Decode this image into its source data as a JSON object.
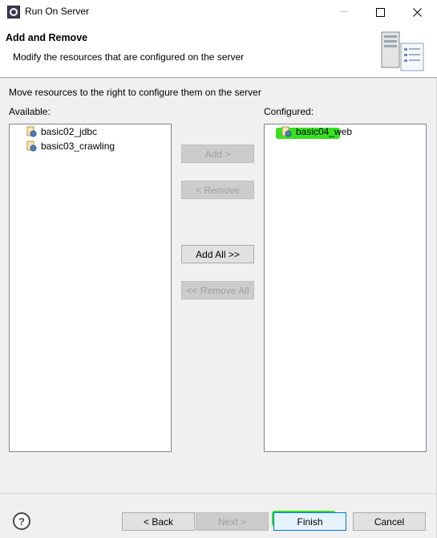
{
  "window": {
    "title": "Run On Server"
  },
  "banner": {
    "title": "Add and Remove",
    "description": "Modify the resources that are configured on the server"
  },
  "instruction": "Move resources to the right to configure them on the server",
  "available": {
    "label": "Available:",
    "items": [
      {
        "label": "basic02_jdbc"
      },
      {
        "label": "basic03_crawling"
      }
    ]
  },
  "configured": {
    "label": "Configured:",
    "items": [
      {
        "label": "basic04_web"
      }
    ]
  },
  "actions": {
    "add": "Add >",
    "remove": "< Remove",
    "add_all": "Add All >>",
    "remove_all": "<< Remove All"
  },
  "footer": {
    "help": "?",
    "back": "< Back",
    "next": "Next >",
    "finish": "Finish",
    "cancel": "Cancel"
  },
  "colors": {
    "highlight": "#35e21f",
    "finish_border": "#0078d7"
  }
}
